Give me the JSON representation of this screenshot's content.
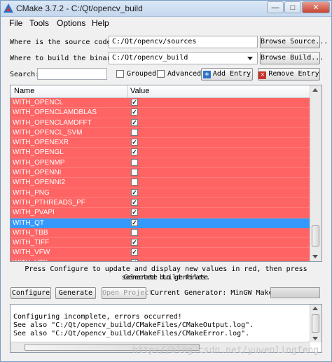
{
  "window": {
    "title": "CMake 3.7.2 - C:/Qt/opencv_build"
  },
  "menu": [
    "File",
    "Tools",
    "Options",
    "Help"
  ],
  "source": {
    "label": "Where is the source code:",
    "value": "C:/Qt/opencv/sources",
    "browse": "Browse Source..."
  },
  "build": {
    "label": "Where to build the binaries:",
    "value": "C:/Qt/opencv_build",
    "browse": "Browse Build..."
  },
  "search": {
    "label": "Search:",
    "value": ""
  },
  "options": {
    "grouped": "Grouped",
    "advanced": "Advanced",
    "add_entry": "Add Entry",
    "remove_entry": "Remove Entry"
  },
  "table": {
    "headers": {
      "name": "Name",
      "value": "Value"
    },
    "rows": [
      {
        "name": "WITH_OPENCL",
        "checked": true,
        "selected": false
      },
      {
        "name": "WITH_OPENCLAMDBLAS",
        "checked": true,
        "selected": false
      },
      {
        "name": "WITH_OPENCLAMDFFT",
        "checked": true,
        "selected": false
      },
      {
        "name": "WITH_OPENCL_SVM",
        "checked": false,
        "selected": false
      },
      {
        "name": "WITH_OPENEXR",
        "checked": true,
        "selected": false
      },
      {
        "name": "WITH_OPENGL",
        "checked": true,
        "selected": false
      },
      {
        "name": "WITH_OPENMP",
        "checked": false,
        "selected": false
      },
      {
        "name": "WITH_OPENNI",
        "checked": false,
        "selected": false
      },
      {
        "name": "WITH_OPENNI2",
        "checked": false,
        "selected": false
      },
      {
        "name": "WITH_PNG",
        "checked": true,
        "selected": false
      },
      {
        "name": "WITH_PTHREADS_PF",
        "checked": true,
        "selected": false
      },
      {
        "name": "WITH_PVAPI",
        "checked": true,
        "selected": false
      },
      {
        "name": "WITH_QT",
        "checked": true,
        "selected": true
      },
      {
        "name": "WITH_TBB",
        "checked": false,
        "selected": false
      },
      {
        "name": "WITH_TIFF",
        "checked": true,
        "selected": false
      },
      {
        "name": "WITH_VFW",
        "checked": true,
        "selected": false
      },
      {
        "name": "WITH_VTK",
        "checked": true,
        "selected": false
      }
    ]
  },
  "hint": {
    "line1": "Press Configure to update and display new values in red, then press Generate to generate",
    "line2": "selected build files."
  },
  "actions": {
    "configure": "Configure",
    "generate": "Generate",
    "open_project": "Open Project",
    "generator": "Current Generator: MinGW Makefiles"
  },
  "output": {
    "lines": [
      "Configuring incomplete, errors occurred!",
      "See also \"C:/Qt/opencv_build/CMakeFiles/CMakeOutput.log\".",
      "See also \"C:/Qt/opencv_build/CMakeFiles/CMakeError.log\"."
    ]
  },
  "watermark": "http://blog.csdn.net/yuwenlingfeng",
  "colors": {
    "changed_row": "#ff6464",
    "selected_row": "#3399ff",
    "titlebar": "#c4d7ee"
  }
}
